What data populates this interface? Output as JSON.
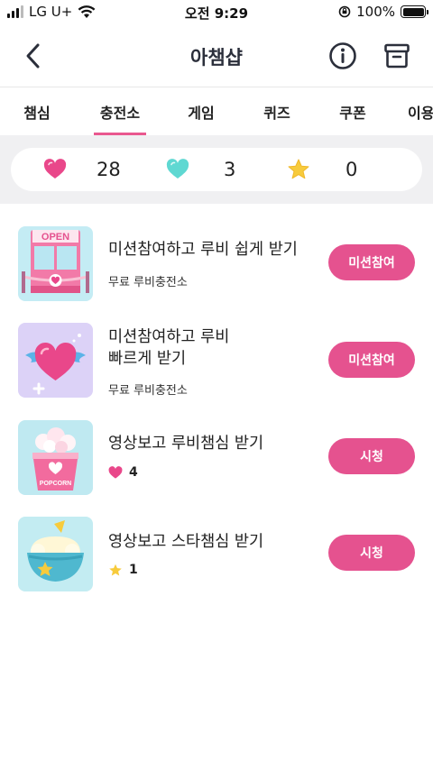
{
  "status_bar": {
    "carrier": "LG U+",
    "time": "오전 9:29",
    "battery": "100%"
  },
  "header": {
    "title": "아챔샵"
  },
  "tabs": [
    {
      "label": "챔심",
      "active": false
    },
    {
      "label": "충전소",
      "active": true
    },
    {
      "label": "게임",
      "active": false
    },
    {
      "label": "퀴즈",
      "active": false
    },
    {
      "label": "쿠폰",
      "active": false
    },
    {
      "label": "이용",
      "active": false
    }
  ],
  "points": {
    "ruby": "28",
    "heart": "3",
    "star": "0"
  },
  "items": [
    {
      "title": "미션참여하고 루비 쉽게 받기",
      "subtitle": "무료 루비충전소",
      "button": "미션참여",
      "thumb": "open-store-icon"
    },
    {
      "title_line1": "미션참여하고 루비",
      "title_line2": "빠르게 받기",
      "subtitle": "무료 루비충전소",
      "button": "미션참여",
      "thumb": "winged-heart-icon"
    },
    {
      "title": "영상보고 루비챔심 받기",
      "reward": "4",
      "button": "시청",
      "thumb": "popcorn-icon"
    },
    {
      "title": "영상보고 스타챔심 받기",
      "reward": "1",
      "button": "시청",
      "thumb": "star-bowl-icon"
    }
  ],
  "thumb_texts": {
    "open_sign": "OPEN",
    "popcorn_label": "POPCORN"
  },
  "colors": {
    "accent": "#e5528f",
    "ruby": "#e9478a",
    "heart_teal": "#5fd8d2",
    "star": "#f7cb3c"
  }
}
